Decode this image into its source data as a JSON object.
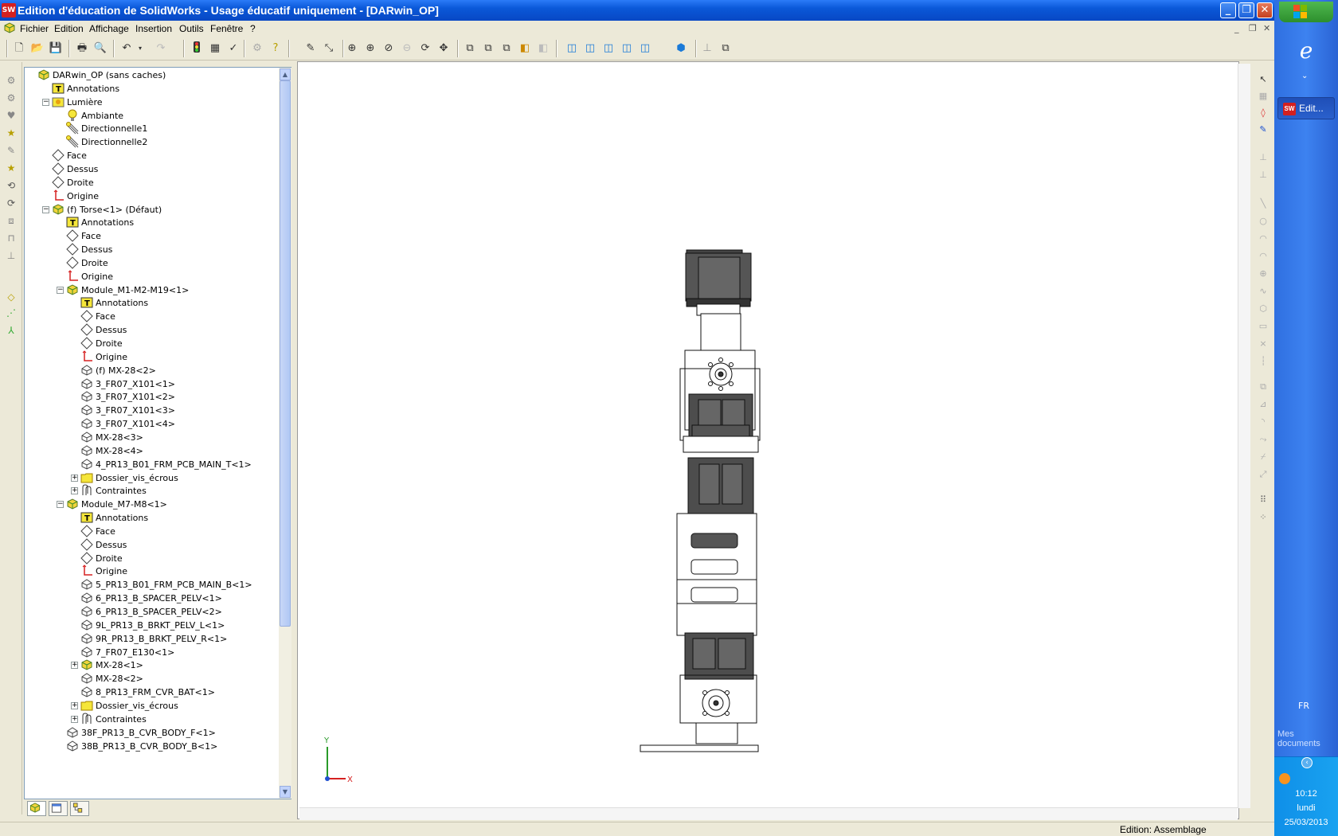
{
  "window": {
    "title": "Edition d'éducation de SolidWorks - Usage éducatif uniquement - [DARwin_OP]",
    "logo_text": "SW"
  },
  "menu": [
    "Fichier",
    "Edition",
    "Affichage",
    "Insertion",
    "Outils",
    "Fenêtre",
    "?"
  ],
  "tree": [
    {
      "label": "DARwin_OP  (sans caches)",
      "level": 0,
      "icon": "assembly-icon",
      "expander": ""
    },
    {
      "label": "Annotations",
      "level": 1,
      "icon": "annotations-icon",
      "expander": ""
    },
    {
      "label": "Lumière",
      "level": 1,
      "icon": "lights-icon",
      "expander": "-"
    },
    {
      "label": "Ambiante",
      "level": 2,
      "icon": "bulb-icon",
      "expander": ""
    },
    {
      "label": "Directionnelle1",
      "level": 2,
      "icon": "directional-light-icon",
      "expander": ""
    },
    {
      "label": "Directionnelle2",
      "level": 2,
      "icon": "directional-light-icon",
      "expander": ""
    },
    {
      "label": "Face",
      "level": 1,
      "icon": "plane-icon",
      "expander": ""
    },
    {
      "label": "Dessus",
      "level": 1,
      "icon": "plane-icon",
      "expander": ""
    },
    {
      "label": "Droite",
      "level": 1,
      "icon": "plane-icon",
      "expander": ""
    },
    {
      "label": "Origine",
      "level": 1,
      "icon": "origin-icon",
      "expander": ""
    },
    {
      "label": "(f) Torse<1> (Défaut)",
      "level": 1,
      "icon": "subassembly-icon",
      "expander": "-"
    },
    {
      "label": "Annotations",
      "level": 2,
      "icon": "annotations-icon",
      "expander": ""
    },
    {
      "label": "Face",
      "level": 2,
      "icon": "plane-icon",
      "expander": ""
    },
    {
      "label": "Dessus",
      "level": 2,
      "icon": "plane-icon",
      "expander": ""
    },
    {
      "label": "Droite",
      "level": 2,
      "icon": "plane-icon",
      "expander": ""
    },
    {
      "label": "Origine",
      "level": 2,
      "icon": "origin-icon",
      "expander": ""
    },
    {
      "label": "Module_M1-M2-M19<1>",
      "level": 2,
      "icon": "subassembly-icon",
      "expander": "-"
    },
    {
      "label": "Annotations",
      "level": 3,
      "icon": "annotations-icon",
      "expander": ""
    },
    {
      "label": "Face",
      "level": 3,
      "icon": "plane-icon",
      "expander": ""
    },
    {
      "label": "Dessus",
      "level": 3,
      "icon": "plane-icon",
      "expander": ""
    },
    {
      "label": "Droite",
      "level": 3,
      "icon": "plane-icon",
      "expander": ""
    },
    {
      "label": "Origine",
      "level": 3,
      "icon": "origin-icon",
      "expander": ""
    },
    {
      "label": "(f) MX-28<2>",
      "level": 3,
      "icon": "part-icon",
      "expander": ""
    },
    {
      "label": "3_FR07_X101<1>",
      "level": 3,
      "icon": "part-icon",
      "expander": ""
    },
    {
      "label": "3_FR07_X101<2>",
      "level": 3,
      "icon": "part-icon",
      "expander": ""
    },
    {
      "label": "3_FR07_X101<3>",
      "level": 3,
      "icon": "part-icon",
      "expander": ""
    },
    {
      "label": "3_FR07_X101<4>",
      "level": 3,
      "icon": "part-icon",
      "expander": ""
    },
    {
      "label": "MX-28<3>",
      "level": 3,
      "icon": "part-icon",
      "expander": ""
    },
    {
      "label": "MX-28<4>",
      "level": 3,
      "icon": "part-icon",
      "expander": ""
    },
    {
      "label": "4_PR13_B01_FRM_PCB_MAIN_T<1>",
      "level": 3,
      "icon": "part-icon",
      "expander": ""
    },
    {
      "label": "Dossier_vis_écrous",
      "level": 3,
      "icon": "folder-icon",
      "expander": "+"
    },
    {
      "label": "Contraintes",
      "level": 3,
      "icon": "mates-icon",
      "expander": "+"
    },
    {
      "label": "Module_M7-M8<1>",
      "level": 2,
      "icon": "subassembly-icon",
      "expander": "-"
    },
    {
      "label": "Annotations",
      "level": 3,
      "icon": "annotations-icon",
      "expander": ""
    },
    {
      "label": "Face",
      "level": 3,
      "icon": "plane-icon",
      "expander": ""
    },
    {
      "label": "Dessus",
      "level": 3,
      "icon": "plane-icon",
      "expander": ""
    },
    {
      "label": "Droite",
      "level": 3,
      "icon": "plane-icon",
      "expander": ""
    },
    {
      "label": "Origine",
      "level": 3,
      "icon": "origin-icon",
      "expander": ""
    },
    {
      "label": "5_PR13_B01_FRM_PCB_MAIN_B<1>",
      "level": 3,
      "icon": "part-icon",
      "expander": ""
    },
    {
      "label": "6_PR13_B_SPACER_PELV<1>",
      "level": 3,
      "icon": "part-icon",
      "expander": ""
    },
    {
      "label": "6_PR13_B_SPACER_PELV<2>",
      "level": 3,
      "icon": "part-icon",
      "expander": ""
    },
    {
      "label": "9L_PR13_B_BRKT_PELV_L<1>",
      "level": 3,
      "icon": "part-icon",
      "expander": ""
    },
    {
      "label": "9R_PR13_B_BRKT_PELV_R<1>",
      "level": 3,
      "icon": "part-icon",
      "expander": ""
    },
    {
      "label": "7_FR07_E130<1>",
      "level": 3,
      "icon": "part-icon",
      "expander": ""
    },
    {
      "label": "MX-28<1>",
      "level": 3,
      "icon": "subassembly-icon",
      "expander": "+"
    },
    {
      "label": "MX-28<2>",
      "level": 3,
      "icon": "part-icon",
      "expander": ""
    },
    {
      "label": "8_PR13_FRM_CVR_BAT<1>",
      "level": 3,
      "icon": "part-icon",
      "expander": ""
    },
    {
      "label": "Dossier_vis_écrous",
      "level": 3,
      "icon": "folder-icon",
      "expander": "+"
    },
    {
      "label": "Contraintes",
      "level": 3,
      "icon": "mates-icon",
      "expander": "+"
    },
    {
      "label": "38F_PR13_B_CVR_BODY_F<1>",
      "level": 2,
      "icon": "part-icon",
      "expander": ""
    },
    {
      "label": "38B_PR13_B_CVR_BODY_B<1>",
      "level": 2,
      "icon": "part-icon",
      "expander": ""
    }
  ],
  "triad": {
    "y_label": "Y",
    "x_label": "X"
  },
  "status": {
    "text": "Edition: Assemblage"
  },
  "taskbar": {
    "app_button": "Edit...",
    "app_logo": "SW",
    "language": "FR",
    "docs_label": "Mes documents",
    "time": "10:12",
    "day": "lundi",
    "date": "25/03/2013"
  },
  "colors": {
    "titlebar": "#0a58d8",
    "tree_bg": "#ffffff",
    "viewport_bg": "#ffffff",
    "taskbar": "#3d82f0",
    "model_dark": "#4d4d4d"
  }
}
